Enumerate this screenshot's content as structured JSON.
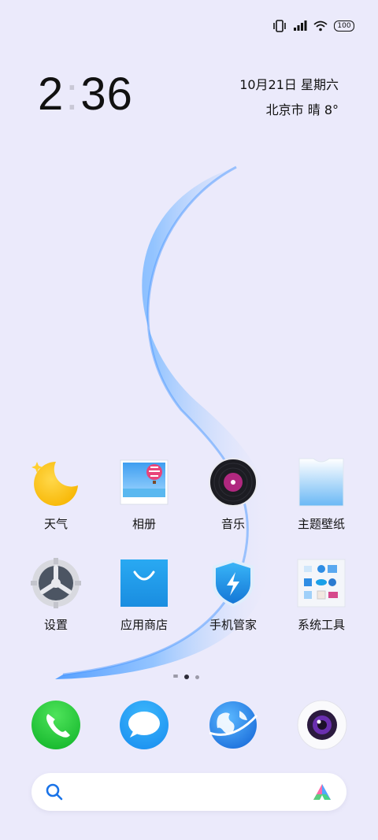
{
  "status": {
    "battery": "100"
  },
  "clock": {
    "hour": "2",
    "colon": ":",
    "minute": "36"
  },
  "date": "10月21日 星期六",
  "weather": "北京市 晴 8°",
  "apps": [
    {
      "label": "天气",
      "icon": "weather-icon"
    },
    {
      "label": "相册",
      "icon": "gallery-icon"
    },
    {
      "label": "音乐",
      "icon": "music-icon"
    },
    {
      "label": "主题壁纸",
      "icon": "themes-icon"
    },
    {
      "label": "设置",
      "icon": "settings-icon"
    },
    {
      "label": "应用商店",
      "icon": "app-store-icon"
    },
    {
      "label": "手机管家",
      "icon": "phone-manager-icon"
    },
    {
      "label": "系统工具",
      "icon": "system-tools-icon"
    }
  ],
  "dock": [
    {
      "icon": "phone-icon"
    },
    {
      "icon": "messages-icon"
    },
    {
      "icon": "browser-icon"
    },
    {
      "icon": "camera-icon"
    }
  ],
  "search": {
    "icon": "search-icon",
    "assistant_icon": "assistant-icon"
  },
  "colors": {
    "wallpaper": "#ebeafb",
    "swoosh": "#5aa6ff",
    "text": "#111111"
  }
}
